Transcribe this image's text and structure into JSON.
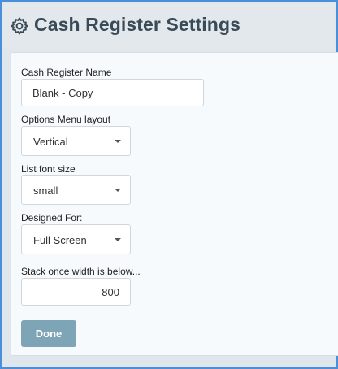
{
  "header": {
    "icon": "gear-icon",
    "title": "Cash Register Settings"
  },
  "form": {
    "name": {
      "label": "Cash Register Name",
      "value": "Blank - Copy"
    },
    "options_menu_layout": {
      "label": "Options Menu layout",
      "value": "Vertical",
      "icon": "caret-down-icon"
    },
    "list_font_size": {
      "label": "List font size",
      "value": "small",
      "icon": "caret-down-icon"
    },
    "designed_for": {
      "label": "Designed For:",
      "value": "Full Screen",
      "icon": "caret-down-icon"
    },
    "stack_width": {
      "label": "Stack once width is below...",
      "value": "800"
    },
    "done_label": "Done"
  },
  "colors": {
    "frame_border": "#4a90d9",
    "title_text": "#3a4a56",
    "button_bg": "#7ea5b6",
    "panel_bg": "#f7fafc"
  }
}
